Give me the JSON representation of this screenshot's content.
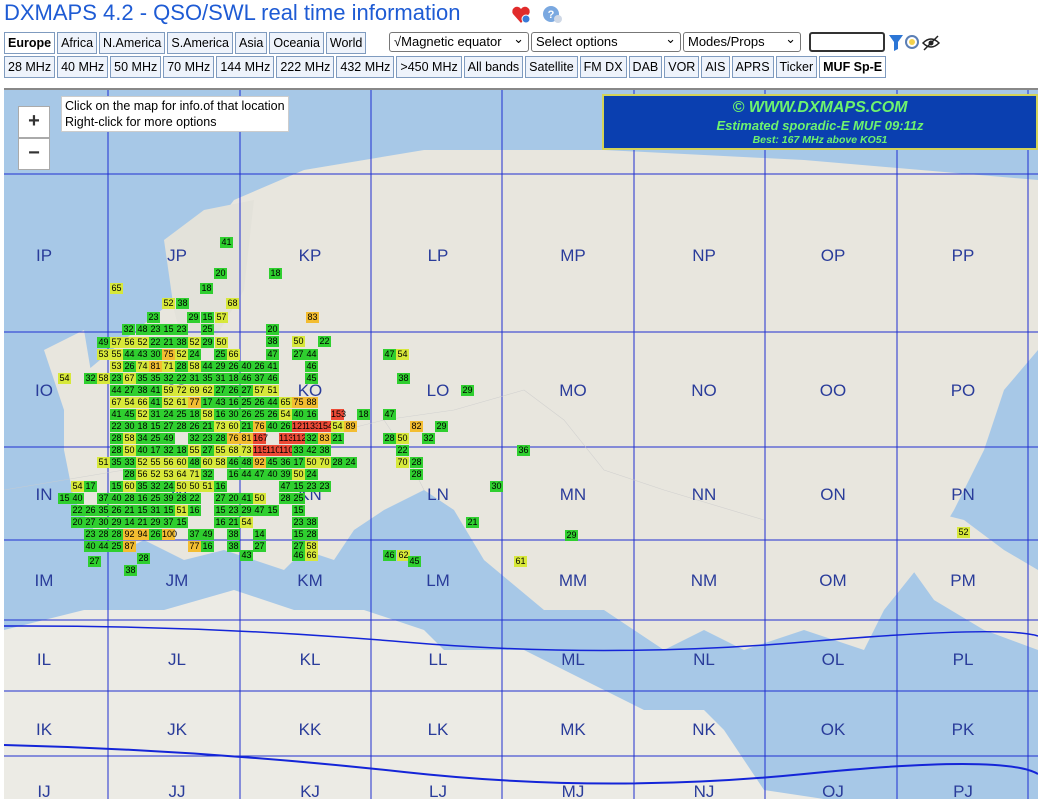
{
  "app": {
    "title": "DXMAPS 4.2 - QSO/SWL real time information"
  },
  "regions": [
    "Europe",
    "Africa",
    "N.America",
    "S.America",
    "Asia",
    "Oceania",
    "World"
  ],
  "active_region": "Europe",
  "selects": {
    "magnetic": "√Magnetic equator",
    "options": "Select options",
    "modes": "Modes/Props"
  },
  "bands": [
    "28 MHz",
    "40 MHz",
    "50 MHz",
    "70 MHz",
    "144 MHz",
    "222 MHz",
    "432 MHz",
    ">450 MHz",
    "All bands",
    "Satellite",
    "FM DX",
    "DAB",
    "VOR",
    "AIS",
    "APRS",
    "Ticker",
    "MUF Sp-E"
  ],
  "active_band": "MUF Sp-E",
  "map": {
    "zoom_in": "+",
    "zoom_out": "−",
    "tip_line1": "Click on the map for info.of that location",
    "tip_line2": "Right-click for more options",
    "brand_line1": "© WWW.DXMAPS.COM",
    "brand_line2": "Estimated sporadic-E MUF 09:11z",
    "brand_line3": "Best: 167 MHz above KO51",
    "grid_labels": [
      "IP",
      "JP",
      "KP",
      "LP",
      "MP",
      "NP",
      "OP",
      "PP",
      "IO",
      "JO",
      "KO",
      "LO",
      "MO",
      "NO",
      "OO",
      "PO",
      "IN",
      "JN",
      "KN",
      "LN",
      "MN",
      "NN",
      "ON",
      "PN",
      "IM",
      "JM",
      "KM",
      "LM",
      "MM",
      "NM",
      "OM",
      "PM",
      "IL",
      "JL",
      "KL",
      "LL",
      "ML",
      "NL",
      "OL",
      "PL",
      "IK",
      "JK",
      "KK",
      "LK",
      "MK",
      "NK",
      "OK",
      "PK",
      "IJ",
      "JJ",
      "KJ",
      "LJ",
      "MJ",
      "NJ",
      "OJ",
      "PJ"
    ],
    "muf_values": [
      "41",
      "20",
      "18",
      "65",
      "52",
      "38",
      "18",
      "68",
      "23",
      "29",
      "15",
      "57",
      "32",
      "48",
      "23",
      "15",
      "23",
      "25",
      "20",
      "38",
      "50",
      "22",
      "83",
      "49",
      "57",
      "56",
      "52",
      "22",
      "21",
      "38",
      "52",
      "29",
      "50",
      "53",
      "55",
      "44",
      "43",
      "30",
      "75",
      "52",
      "24",
      "25",
      "66",
      "47",
      "27",
      "44",
      "47",
      "54",
      "53",
      "26",
      "74",
      "81",
      "71",
      "28",
      "58",
      "44",
      "29",
      "26",
      "40",
      "26",
      "41",
      "46",
      "54",
      "32",
      "58",
      "23",
      "67",
      "35",
      "35",
      "32",
      "22",
      "31",
      "35",
      "31",
      "18",
      "46",
      "37",
      "46",
      "45",
      "38",
      "29",
      "44",
      "27",
      "38",
      "41",
      "59",
      "72",
      "69",
      "62",
      "27",
      "26",
      "27",
      "57",
      "51",
      "67",
      "54",
      "66",
      "41",
      "52",
      "61",
      "77",
      "17",
      "43",
      "16",
      "25",
      "26",
      "44",
      "65",
      "75",
      "88",
      "41",
      "45",
      "52",
      "31",
      "24",
      "25",
      "18",
      "58",
      "16",
      "30",
      "26",
      "25",
      "26",
      "54",
      "40",
      "16",
      "153",
      "18",
      "47",
      "22",
      "30",
      "18",
      "15",
      "27",
      "28",
      "26",
      "21",
      "73",
      "60",
      "21",
      "76",
      "40",
      "26",
      "121",
      "133",
      "154",
      "54",
      "89",
      "82",
      "29",
      "28",
      "58",
      "34",
      "25",
      "49",
      "32",
      "23",
      "28",
      "76",
      "81",
      "167",
      "113",
      "112",
      "32",
      "83",
      "21",
      "28",
      "50",
      "32",
      "28",
      "50",
      "40",
      "17",
      "32",
      "18",
      "55",
      "27",
      "55",
      "68",
      "73",
      "115",
      "110",
      "110",
      "33",
      "42",
      "38",
      "22",
      "36",
      "51",
      "35",
      "33",
      "52",
      "55",
      "56",
      "60",
      "48",
      "60",
      "58",
      "46",
      "48",
      "92",
      "45",
      "36",
      "17",
      "50",
      "70",
      "28",
      "24",
      "70",
      "28",
      "28",
      "56",
      "52",
      "53",
      "64",
      "71",
      "32",
      "16",
      "44",
      "47",
      "40",
      "39",
      "50",
      "24",
      "28",
      "54",
      "17",
      "15",
      "60",
      "35",
      "32",
      "24",
      "50",
      "50",
      "51",
      "16",
      "47",
      "15",
      "23",
      "23",
      "30",
      "15",
      "40",
      "37",
      "40",
      "28",
      "16",
      "25",
      "39",
      "28",
      "22",
      "27",
      "20",
      "41",
      "50",
      "28",
      "25",
      "22",
      "26",
      "35",
      "26",
      "21",
      "15",
      "31",
      "15",
      "51",
      "16",
      "15",
      "23",
      "29",
      "47",
      "15",
      "15",
      "20",
      "27",
      "30",
      "29",
      "14",
      "21",
      "29",
      "37",
      "15",
      "16",
      "21",
      "54",
      "23",
      "38",
      "21",
      "23",
      "28",
      "28",
      "92",
      "94",
      "26",
      "100",
      "37",
      "49",
      "38",
      "14",
      "15",
      "28",
      "40",
      "44",
      "25",
      "87",
      "77",
      "16",
      "38",
      "27",
      "27",
      "58",
      "27",
      "28",
      "38",
      "43",
      "46",
      "66",
      "46",
      "62",
      "45",
      "61",
      "29",
      "52"
    ]
  }
}
